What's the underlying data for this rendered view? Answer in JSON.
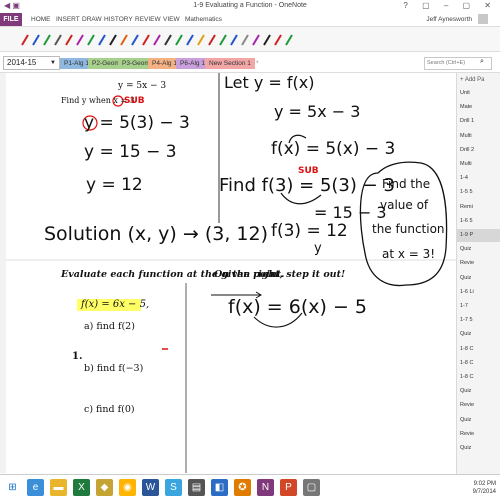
{
  "window": {
    "title": "1-9 Evaluating a Function - OneNote",
    "controls": "? ▢ – ▢ ✕"
  },
  "ribbon": {
    "file": "FILE",
    "tabs": [
      "HOME",
      "INSERT",
      "DRAW",
      "HISTORY",
      "REVIEW",
      "VIEW",
      "Mathematics"
    ],
    "user": "Jeff Aynesworth"
  },
  "notebook": {
    "name": "2014-15"
  },
  "section_tabs": [
    {
      "label": "P1-Alg 1",
      "color": "#8fb7e0"
    },
    {
      "label": "P2-Geom",
      "color": "#a8d08d"
    },
    {
      "label": "P3-Geom",
      "color": "#a8d08d"
    },
    {
      "label": "P4-Alg 1",
      "color": "#f4b183"
    },
    {
      "label": "P6-Alg 1",
      "color": "#c9a0dc"
    },
    {
      "label": "New Section 1",
      "color": "#f3a6a6"
    }
  ],
  "search": {
    "placeholder": "Search (Ctrl+E)"
  },
  "pagelist": {
    "add_page": "+ Add Pa",
    "items": [
      "Unit",
      "Mate",
      "Drill 1",
      "Multi",
      "Drill 2",
      "Multi",
      "1-4",
      "1-5 5",
      "Remi",
      "1-6 5",
      "1-9 P",
      "Quiz",
      "Revie",
      "Quiz",
      "1-6 Li",
      "1-7",
      "1-7 5",
      "Quiz",
      "1-8 C",
      "1-8 C",
      "1-8 C",
      "Quiz",
      "Revie",
      "Quiz",
      "Revie",
      "Quiz"
    ]
  },
  "page": {
    "top_equation": "y = 5x − 3",
    "find_text": "Find y when x = 3",
    "sub_label": "SUB",
    "left_steps": [
      "y = 5(3) − 3",
      "y = 15 − 3",
      "y = 12"
    ],
    "solution_text": "Solution (x, y) → (3, 12)",
    "right_steps": [
      "Let y = f(x)",
      "y = 5x − 3",
      "f(x) = 5(x) − 3",
      "Find f(3) = 5(3) − 3",
      "= 15 − 3",
      "f(3) = 12",
      "y"
    ],
    "right_sub_label": "SUB",
    "bubble_text": [
      "Find the",
      "value of",
      "the function",
      "at x = 3!"
    ],
    "evaluate_instruction": "Evaluate each function at the given point.",
    "right_instruction": "On the right, step it out!",
    "problem_number": "1.",
    "function_def": "f(x) = 6x − 5,",
    "parts": [
      "a)  find f(2)",
      "b)  find f(−3)",
      "c)  find f(0)"
    ],
    "right_work": "f(x) = 6(x) − 5"
  },
  "taskbar": {
    "time": "9:02 PM",
    "date": "9/7/2014"
  },
  "colors": {
    "brand": "#80397b",
    "ink_red": "#dd1111",
    "highlight": "#ffff66"
  }
}
